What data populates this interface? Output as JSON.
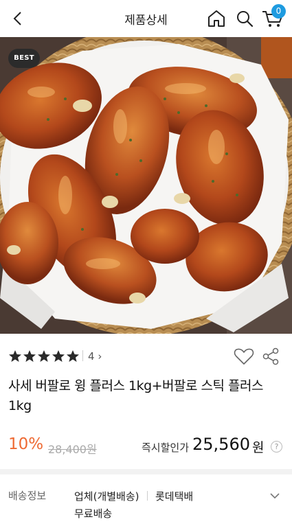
{
  "header": {
    "title": "제품상세",
    "back_icon": "chevron-left-icon",
    "home_icon": "home-icon",
    "search_icon": "search-icon",
    "cart_icon": "cart-icon",
    "cart_count": "0",
    "cart_badge_color": "#1e9be0"
  },
  "hero": {
    "badge": "BEST"
  },
  "rating": {
    "stars": 5,
    "review_count": "4",
    "arrow": "›"
  },
  "actions": {
    "wish_icon": "heart-outline-icon",
    "share_icon": "share-icon"
  },
  "product": {
    "name": "사세 버팔로 윙 플러스 1kg+버팔로 스틱 플러스 1kg"
  },
  "price": {
    "discount": "10%",
    "discount_color": "#ee6a33",
    "original": "28,400원",
    "sale_label": "즉시할인가",
    "sale_price": "25,560",
    "currency": "원",
    "help": "?"
  },
  "shipping": {
    "label": "배송정보",
    "vendor": "업체(개별배송)",
    "carrier": "롯데택배",
    "fee": "무료배송"
  }
}
